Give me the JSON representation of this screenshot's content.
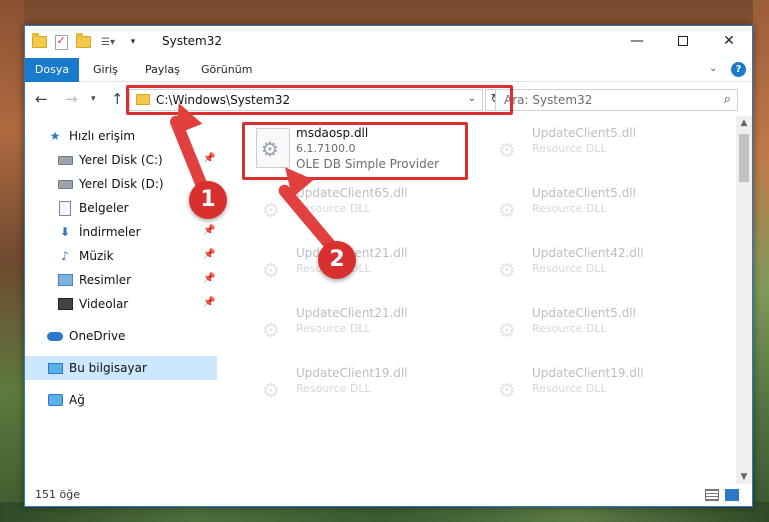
{
  "window": {
    "title": "System32"
  },
  "ribbon": {
    "tabs": [
      "Dosya",
      "Giriş",
      "Paylaş",
      "Görünüm"
    ]
  },
  "address": {
    "path": "C:\\Windows\\System32"
  },
  "search": {
    "placeholder": "Ara: System32"
  },
  "sidebar": {
    "items": [
      {
        "label": "Hızlı erişim",
        "icon": "star-icon"
      },
      {
        "label": "Yerel Disk (C:)",
        "icon": "disk-icon",
        "pinned": true
      },
      {
        "label": "Yerel Disk (D:)",
        "icon": "disk-icon"
      },
      {
        "label": "Belgeler",
        "icon": "documents-icon"
      },
      {
        "label": "İndirmeler",
        "icon": "download-icon",
        "pinned": true
      },
      {
        "label": "Müzik",
        "icon": "music-icon",
        "pinned": true
      },
      {
        "label": "Resimler",
        "icon": "pictures-icon",
        "pinned": true
      },
      {
        "label": "Videolar",
        "icon": "videos-icon",
        "pinned": true
      },
      {
        "label": "OneDrive",
        "icon": "onedrive-icon"
      },
      {
        "label": "Bu bilgisayar",
        "icon": "this-pc-icon",
        "selected": true
      },
      {
        "label": "Ağ",
        "icon": "network-icon"
      }
    ]
  },
  "files": [
    {
      "name": "msdaosp.dll",
      "version": "6.1.7100.0",
      "description": "OLE DB Simple Provider",
      "highlighted": true
    },
    {
      "name": "UpdateClient5.dll",
      "description": "Resource DLL"
    },
    {
      "name": "UpdateClient65.dll",
      "description": "Resource DLL"
    },
    {
      "name": "UpdateClient5.dll",
      "description": "Resource DLL"
    },
    {
      "name": "UpdateClient21.dll",
      "description": "Resource DLL"
    },
    {
      "name": "UpdateClient42.dll",
      "description": "Resource DLL"
    },
    {
      "name": "UpdateClient21.dll",
      "description": "Resource DLL"
    },
    {
      "name": "UpdateClient5.dll",
      "description": "Resource DLL"
    },
    {
      "name": "UpdateClient19.dll",
      "description": "Resource DLL"
    },
    {
      "name": "UpdateClient19.dll",
      "description": "Resource DLL"
    }
  ],
  "status": {
    "count": "151 öğe"
  },
  "annotations": {
    "step1": "1",
    "step2": "2",
    "color": "#d8302f"
  }
}
